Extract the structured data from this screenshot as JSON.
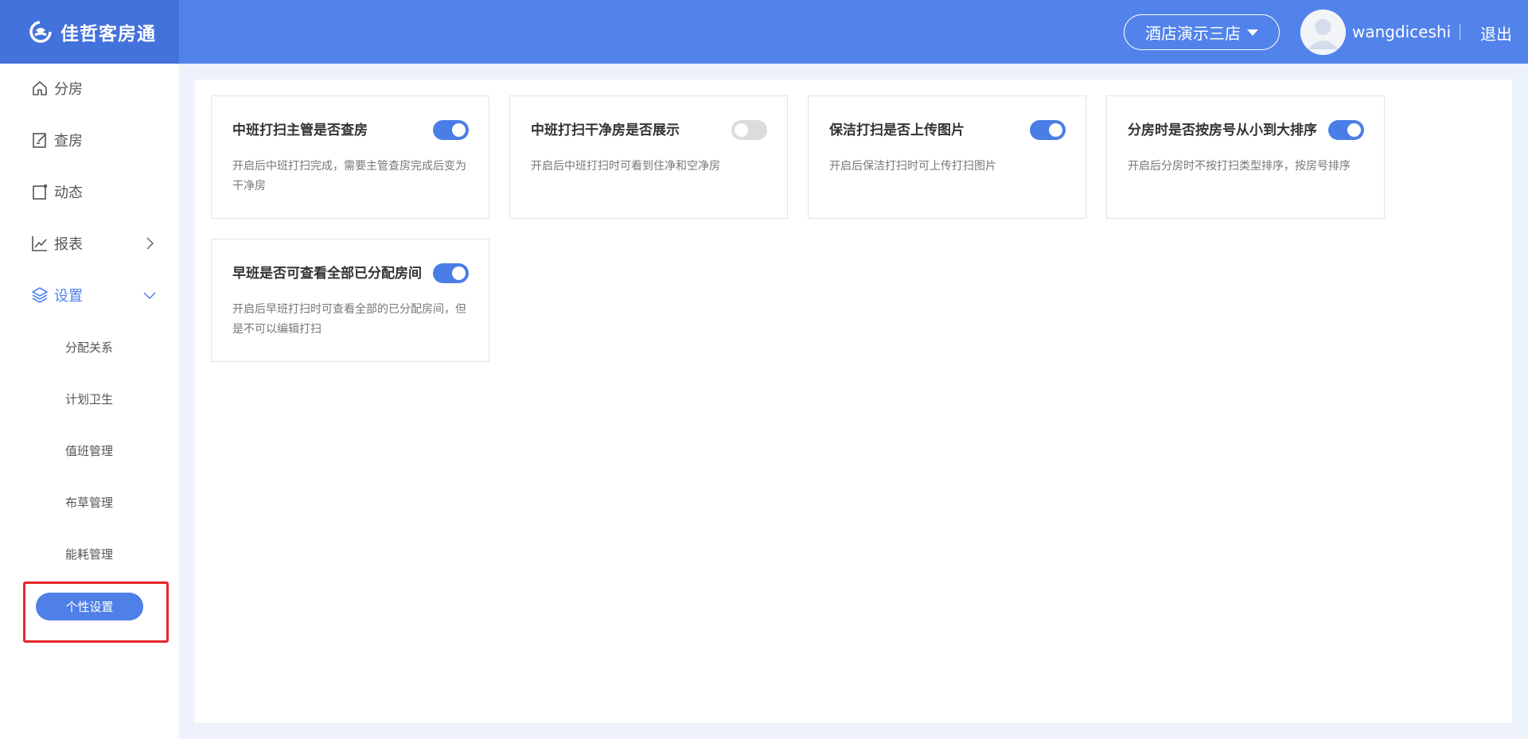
{
  "header": {
    "brand_name": "佳哲客房通",
    "hotel_name": "酒店演示三店",
    "username": "wangdiceshi",
    "logout_label": "退出"
  },
  "sidebar": {
    "items": [
      {
        "label": "分房",
        "icon": "home-icon"
      },
      {
        "label": "查房",
        "icon": "edit-note-icon"
      },
      {
        "label": "动态",
        "icon": "dynamic-icon"
      },
      {
        "label": "报表",
        "icon": "chart-line-icon"
      },
      {
        "label": "设置",
        "icon": "layers-icon"
      }
    ],
    "settings_sub": [
      "分配关系",
      "计划卫生",
      "值班管理",
      "布草管理",
      "能耗管理",
      "个性设置"
    ]
  },
  "cards": [
    {
      "title": "中班打扫主管是否查房",
      "desc": "开启后中班打扫完成，需要主管查房完成后变为干净房",
      "enabled": true
    },
    {
      "title": "中班打扫干净房是否展示",
      "desc": "开启后中班打扫时可看到住净和空净房",
      "enabled": false
    },
    {
      "title": "保洁打扫是否上传图片",
      "desc": "开启后保洁打扫时可上传打扫图片",
      "enabled": true
    },
    {
      "title": "分房时是否按房号从小到大排序",
      "desc": "开启后分房时不按打扫类型排序，按房号排序",
      "enabled": true
    },
    {
      "title": "早班是否可查看全部已分配房间",
      "desc": "开启后早班打扫时可查看全部的已分配房间，但是不可以编辑打扫",
      "enabled": true
    }
  ],
  "colors": {
    "header": "#5183ea",
    "brand_bg": "#4472db",
    "accent": "#4a7ee6",
    "highlight": "#e8262a"
  }
}
